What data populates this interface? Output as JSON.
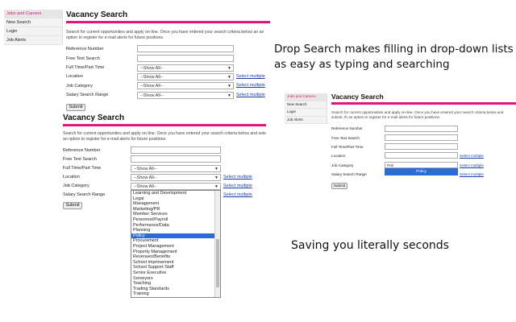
{
  "panel_top": {
    "sidebar": [
      "Jobs and Careers",
      "New Search",
      "Login",
      "Job Alerts"
    ],
    "title": "Vacancy Search",
    "intro": "Search for current opportunities and apply on-line. Once you have entered your search criteria below an an option to register for e-mail alerts for future positions.",
    "labels": [
      "Reference Number",
      "Free Text Search",
      "Full Time/Part Time",
      "Location",
      "Job Category",
      "Salary Search Range"
    ],
    "select_value": "--Show All--",
    "select_multiple": "Select multiple",
    "submit": "Submit"
  },
  "panel_mid": {
    "title": "Vacancy Search",
    "intro": "Search for current opportunities and apply on-line. Once you have entered your search criteria below and sele an option to register for e-mail alerts for future positions.",
    "labels": [
      "Reference Number",
      "Free Text Search",
      "Full Time/Part Time",
      "Location",
      "Job Category",
      "Salary Search Range"
    ],
    "select_value": "--Show All--",
    "select_multiple": "Select multiple",
    "submit": "Submit",
    "dropdown_options": [
      "Learning and Development",
      "Legal",
      "Management",
      "Marketing/PR",
      "Member Services",
      "Personnel/Payroll",
      "Performance/Data",
      "Planning",
      "Policy",
      "Procurement",
      "Project Management",
      "Property Management",
      "Revenues/Benefits",
      "School Improvement",
      "School Support Staff",
      "Senior Executive",
      "Surveyors",
      "Teaching",
      "Trading Standards",
      "Training"
    ],
    "dropdown_selected": "Policy"
  },
  "panel_right": {
    "sidebar": [
      "Jobs and Careers",
      "New Search",
      "Login",
      "Job Alerts"
    ],
    "title": "Vacancy Search",
    "intro": "Search for current opportunities and apply on-line. Once you have entered your search criteria below and submit, th an option to register for e-mail alerts for future positions.",
    "labels": [
      "Reference Number",
      "Free Text Search",
      "Full Time/Part Time",
      "Location",
      "Job Category",
      "Salary Search Range"
    ],
    "typed_value": "Poli",
    "suggestion": "Policy",
    "select_multiple": "Select multiple",
    "submit": "Submit"
  },
  "captions": {
    "headline": "Drop Search makes filling in drop-down lists as easy as typing and searching",
    "tagline": "Saving you literally seconds"
  },
  "colors": {
    "accent": "#e0147a",
    "link": "#1a3fa0",
    "selection": "#2a6bd6"
  }
}
